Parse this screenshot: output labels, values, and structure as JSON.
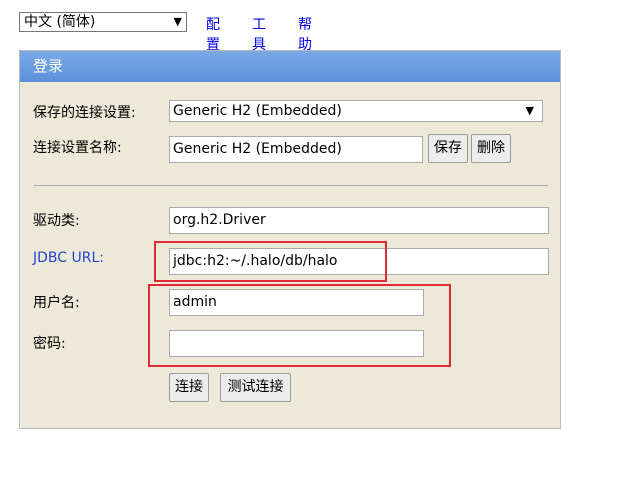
{
  "topbar": {
    "language": "中文 (简体)",
    "links": [
      "配置",
      "工具",
      "帮助"
    ]
  },
  "panel": {
    "title": "登录",
    "saved_settings_label": "保存的连接设置:",
    "saved_settings_value": "Generic H2 (Embedded)",
    "settings_name_label": "连接设置名称:",
    "settings_name_value": "Generic H2 (Embedded)",
    "save_button": "保存",
    "delete_button": "删除",
    "driver_label": "驱动类:",
    "driver_value": "org.h2.Driver",
    "jdbc_label": "JDBC URL:",
    "jdbc_value": "jdbc:h2:~/.halo/db/halo",
    "username_label": "用户名:",
    "username_value": "admin",
    "password_label": "密码:",
    "password_value": "",
    "connect_button": "连接",
    "test_button": "测试连接"
  },
  "colors": {
    "header_blue": "#5b91db",
    "panel_bg": "#ece9d8",
    "highlight_red": "#e12b35",
    "link_blue": "#0000ee"
  },
  "icons": {
    "select_arrow": "dropdown-arrow-icon"
  }
}
